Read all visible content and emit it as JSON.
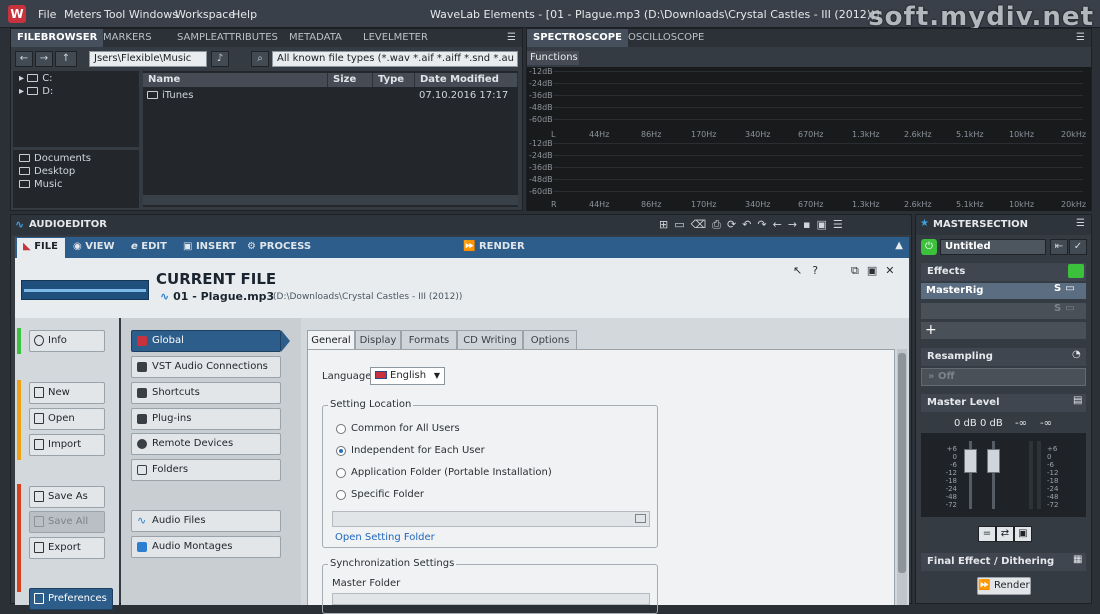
{
  "titlebar": {
    "menu": [
      "File",
      "Meters",
      "Tool Windows",
      "Workspace",
      "Help"
    ],
    "title": "WaveLab Elements - [01 - Plague.mp3 (D:\\Downloads\\Crystal Castles - III (2012))]",
    "watermark": "soft.mydiv.net"
  },
  "filebrowser": {
    "tabs": [
      "FILEBROWSER",
      "MARKERS",
      "SAMPLEATTRIBUTES",
      "METADATA",
      "LEVELMETER"
    ],
    "path": "Jsers\\Flexible\\Music",
    "filetype_filter": "All known file types (*.wav *.aif *.aiff *.snd *.au *.snd *",
    "drives": [
      "C:",
      "D:"
    ],
    "favorites": [
      "Documents",
      "Desktop",
      "Music"
    ],
    "columns": [
      "Name",
      "Size",
      "Type",
      "Date Modified"
    ],
    "rows": [
      {
        "name": "iTunes",
        "size": "",
        "type": "",
        "date": "07.10.2016 17:17"
      }
    ]
  },
  "scope": {
    "tabs": [
      "SPECTROSCOPE",
      "OSCILLOSCOPE"
    ],
    "functions_label": "Functions",
    "db_labels": [
      "-12dB",
      "-24dB",
      "-36dB",
      "-48dB",
      "-60dB"
    ],
    "freq_labels": [
      "44Hz",
      "86Hz",
      "170Hz",
      "340Hz",
      "670Hz",
      "1.3kHz",
      "2.6kHz",
      "5.1kHz",
      "10kHz",
      "20kHz"
    ],
    "channel_labels": [
      "L",
      "R"
    ]
  },
  "audioeditor": {
    "title": "AUDIOEDITOR",
    "ribbon_tabs": [
      "FILE",
      "VIEW",
      "EDIT",
      "INSERT",
      "PROCESS",
      "RENDER"
    ],
    "current_file_heading": "CURRENT FILE",
    "file_name": "01 - Plague.mp3",
    "file_path": "(D:\\Downloads\\Crystal Castles - III (2012))",
    "left_buttons": [
      "Info",
      "New",
      "Open",
      "Import",
      "Save As",
      "Save All",
      "Export",
      "Preferences"
    ],
    "categories": [
      "Global",
      "VST Audio Connections",
      "Shortcuts",
      "Plug-ins",
      "Remote Devices",
      "Folders",
      "Audio Files",
      "Audio Montages"
    ],
    "settings_tabs": [
      "General",
      "Display",
      "Formats",
      "CD Writing",
      "Options"
    ],
    "language_label": "Language",
    "language_value": "English",
    "setting_location_label": "Setting Location",
    "location_options": [
      "Common for All Users",
      "Independent for Each User",
      "Application Folder (Portable Installation)",
      "Specific Folder"
    ],
    "selected_location": 1,
    "open_setting_folder": "Open Setting Folder",
    "sync_settings_label": "Synchronization Settings",
    "master_folder_label": "Master Folder"
  },
  "mastersection": {
    "title": "MASTERSECTION",
    "preset": "Untitled",
    "effects_label": "Effects",
    "effect_slot": "MasterRig",
    "resampling_label": "Resampling",
    "resampling_value": "Off",
    "master_level_label": "Master Level",
    "levels": [
      "0 dB",
      "0 dB",
      "-∞",
      "-∞"
    ],
    "scale": [
      "+6",
      "0",
      "-6",
      "-12",
      "-18",
      "-24",
      "-48",
      "-72"
    ],
    "final_effect_label": "Final Effect / Dithering",
    "render_label": "Render"
  },
  "colors": {
    "accent_green": "#3cc13c",
    "accent_orange": "#f0a010",
    "accent_red": "#d8401c",
    "accent_blue": "#2c7fd0",
    "brand_red": "#c8323c"
  }
}
